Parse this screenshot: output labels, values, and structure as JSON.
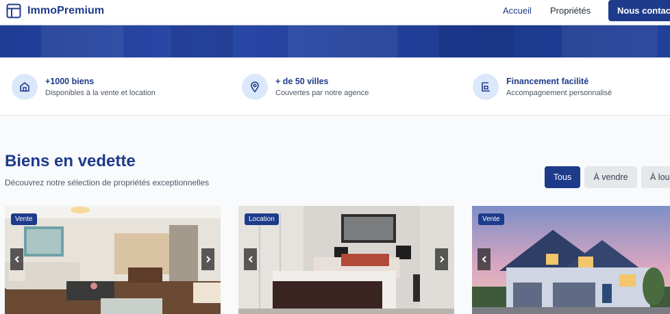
{
  "header": {
    "brand": "ImmoPremium",
    "nav": {
      "home": "Accueil",
      "properties": "Propriétés"
    },
    "contact_button": "Nous contac"
  },
  "features": [
    {
      "icon": "house-icon",
      "title": "+1000 biens",
      "subtitle": "Disponibles à la vente et location"
    },
    {
      "icon": "map-pin-icon",
      "title": "+ de 50 villes",
      "subtitle": "Couvertes par notre agence"
    },
    {
      "icon": "finance-icon",
      "title": "Financement facilité",
      "subtitle": "Accompagnement personnalisé"
    }
  ],
  "featured": {
    "title": "Biens en vedette",
    "subtitle": "Découvrez notre sélection de propriétés exceptionnelles",
    "filters": {
      "all": "Tous",
      "sale": "À vendre",
      "rent": "À lou"
    }
  },
  "cards": [
    {
      "badge": "Vente"
    },
    {
      "badge": "Location"
    },
    {
      "badge": "Vente"
    }
  ],
  "colors": {
    "brand": "#1e3a8a",
    "icon_bg": "#dbe7fb",
    "page_bg": "#f8fafc",
    "filter_inactive": "#e5e7eb"
  }
}
